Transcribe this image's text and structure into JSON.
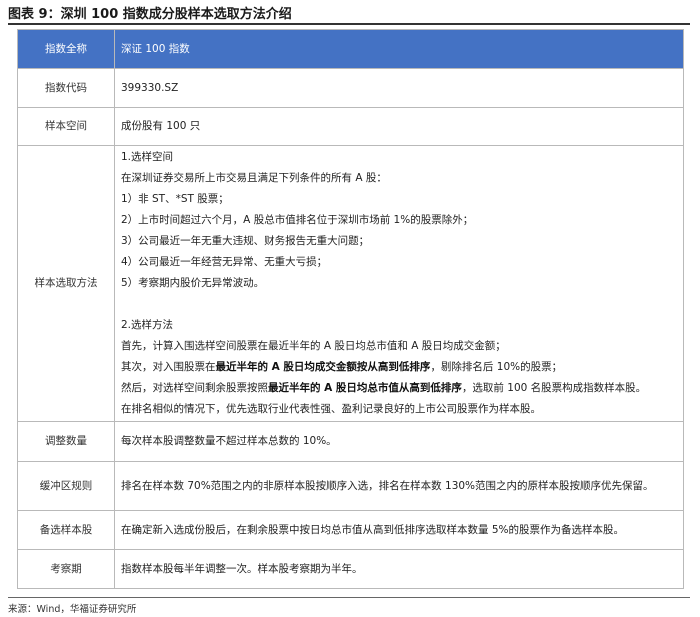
{
  "title": "图表 9：深圳 100 指数成分股样本选取方法介绍",
  "table": {
    "header": {
      "label": "指数全称",
      "value": "深证 100 指数"
    },
    "code": {
      "label": "指数代码",
      "value": "399330.SZ"
    },
    "space": {
      "label": "样本空间",
      "value": "成份股有 100 只"
    },
    "method": {
      "label": "样本选取方法",
      "section1_title": "1.选样空间",
      "intro": "在深圳证券交易所上市交易且满足下列条件的所有 A 股：",
      "conditions": [
        "1）非 ST、*ST 股票；",
        "2）上市时间超过六个月，A 股总市值排名位于深圳市场前 1%的股票除外；",
        "3）公司最近一年无重大违规、财务报告无重大问题；",
        "4）公司最近一年经营无异常、无重大亏损；",
        "5）考察期内股价无异常波动。"
      ],
      "section2_title": "2.选样方法",
      "step1": "首先，计算入围选样空间股票在最近半年的 A 股日均总市值和 A 股日均成交金额；",
      "step2_pre": "其次，对入围股票在",
      "step2_bold": "最近半年的 A 股日均成交金额按从高到低排序",
      "step2_post": "，剔除排名后 10%的股票；",
      "step3_pre": "然后，对选样空间剩余股票按照",
      "step3_bold": "最近半年的 A 股日均总市值从高到低排序",
      "step3_post": "，选取前 100 名股票构成指数样本股。",
      "note": "在排名相似的情况下，优先选取行业代表性强、盈利记录良好的上市公司股票作为样本股。"
    },
    "adjust": {
      "label": "调整数量",
      "value": "每次样本股调整数量不超过样本总数的 10%。"
    },
    "buffer": {
      "label": "缓冲区规则",
      "value": "排名在样本数 70%范围之内的非原样本股按顺序入选，排名在样本数 130%范围之内的原样本股按顺序优先保留。"
    },
    "backup": {
      "label": "备选样本股",
      "value": "在确定新入选成份股后，在剩余股票中按日均总市值从高到低排序选取样本数量 5%的股票作为备选样本股。"
    },
    "review": {
      "label": "考察期",
      "value": "指数样本股每半年调整一次。样本股考察期为半年。"
    }
  },
  "source": "来源：Wind，华福证券研究所",
  "colors": {
    "header_bg": "#4472c4",
    "header_text": "#ffffff",
    "border": "#b9b9b9"
  }
}
